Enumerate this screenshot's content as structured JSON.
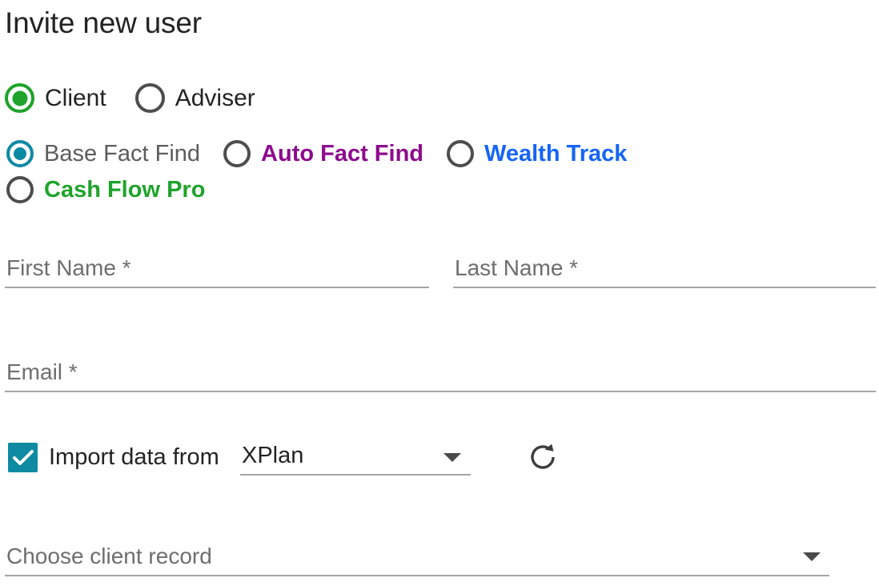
{
  "page": {
    "title": "Invite new user"
  },
  "user_type": {
    "name": "user-type",
    "selected": "Client",
    "options": [
      {
        "label": "Client",
        "selected": true,
        "color": "#1fa32b"
      },
      {
        "label": "Adviser",
        "selected": false,
        "color": "#232323"
      }
    ]
  },
  "product": {
    "name": "product-type",
    "selected": "Base Fact Find",
    "options": [
      {
        "label": "Base Fact Find",
        "selected": true,
        "color": "#5c5c5c"
      },
      {
        "label": "Auto Fact Find",
        "selected": false,
        "color": "#8d0b8d"
      },
      {
        "label": "Wealth Track",
        "selected": false,
        "color": "#1565f5"
      },
      {
        "label": "Cash Flow Pro",
        "selected": false,
        "color": "#1fa32b"
      }
    ]
  },
  "fields": {
    "first_name": {
      "placeholder": "First Name *",
      "value": ""
    },
    "last_name": {
      "placeholder": "Last Name *",
      "value": ""
    },
    "email": {
      "placeholder": "Email *",
      "value": ""
    }
  },
  "import": {
    "checkbox_checked": true,
    "label": "Import data from",
    "source_value": "XPlan",
    "source_options": [
      "XPlan"
    ],
    "refresh_icon": "refresh-icon"
  },
  "client_record": {
    "placeholder": "Choose client record",
    "value": ""
  },
  "colors": {
    "accent_teal": "#0e8aa3",
    "accent_green": "#1fa32b",
    "accent_purple": "#8d0b8d",
    "accent_blue": "#1565f5",
    "underline": "#a6a6a6",
    "text": "#232323",
    "muted_text": "#6e6e6e"
  }
}
